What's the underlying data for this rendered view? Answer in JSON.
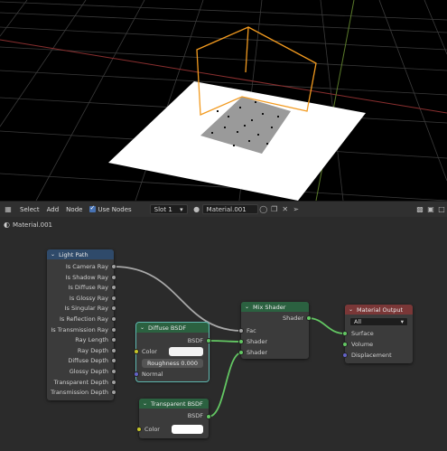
{
  "header": {
    "menus": [
      "Select",
      "Add",
      "Node"
    ],
    "use_nodes_label": "Use Nodes",
    "slot_value": "Slot 1",
    "material_name": "Material.001"
  },
  "breadcrumb": {
    "material": "Material.001"
  },
  "nodes": {
    "light_path": {
      "title": "Light Path",
      "outputs": [
        "Is Camera Ray",
        "Is Shadow Ray",
        "Is Diffuse Ray",
        "Is Glossy Ray",
        "Is Singular Ray",
        "Is Reflection Ray",
        "Is Transmission Ray",
        "Ray Length",
        "Ray Depth",
        "Diffuse Depth",
        "Glossy Depth",
        "Transparent Depth",
        "Transmission Depth"
      ]
    },
    "diffuse": {
      "title": "Diffuse BSDF",
      "output": "BSDF",
      "color_label": "Color",
      "roughness_label": "Roughness",
      "roughness_value": "0.000",
      "normal_label": "Normal"
    },
    "transparent": {
      "title": "Transparent BSDF",
      "output": "BSDF",
      "color_label": "Color"
    },
    "mix": {
      "title": "Mix Shader",
      "output": "Shader",
      "inputs": [
        "Fac",
        "Shader",
        "Shader"
      ]
    },
    "output": {
      "title": "Material Output",
      "target": "All",
      "inputs": [
        "Surface",
        "Volume",
        "Displacement"
      ]
    }
  },
  "colors": {
    "input_header": "#83314a",
    "light_path_header": "#2f4a6a",
    "shader_header": "#2b6140",
    "output_header": "#7a3737",
    "accent": "#4772b3",
    "selection_orange": "#f29a1f"
  }
}
